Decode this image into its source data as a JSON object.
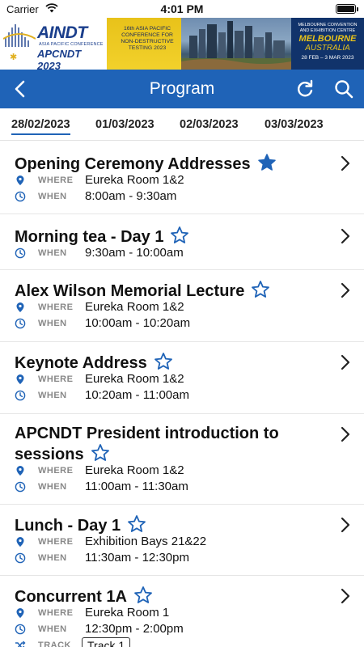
{
  "status_bar": {
    "carrier": "Carrier",
    "time": "4:01 PM"
  },
  "banner": {
    "logo_title": "AINDT",
    "logo_subtitle": "ASIA PACIFIC CONFERENCE",
    "logo_event": "APCNDT 2023",
    "conference_text": "16th ASIA PACIFIC CONFERENCE FOR NON-DESTRUCTIVE TESTING 2023",
    "venue_text": "MELBOURNE CONVENTION AND EXHIBITION CENTRE",
    "city": "MELBOURNE",
    "country": "AUSTRALIA",
    "dates": "28 FEB – 3 MAR 2023"
  },
  "navbar": {
    "title": "Program"
  },
  "tabs": [
    "28/02/2023",
    "01/03/2023",
    "02/03/2023",
    "03/03/2023"
  ],
  "labels": {
    "where": "WHERE",
    "when": "WHEN",
    "track": "TRACK"
  },
  "items": [
    {
      "title": "Opening Ceremony Addresses",
      "starred": true,
      "where": "Eureka Room 1&2",
      "when": "8:00am - 9:30am"
    },
    {
      "title": "Morning tea - Day 1",
      "starred": false,
      "when": "9:30am - 10:00am"
    },
    {
      "title": "Alex Wilson Memorial Lecture",
      "starred": false,
      "where": "Eureka Room 1&2",
      "when": "10:00am - 10:20am"
    },
    {
      "title": "Keynote Address",
      "starred": false,
      "where": "Eureka Room 1&2",
      "when": "10:20am - 11:00am"
    },
    {
      "title": "APCNDT President introduction to sessions",
      "starred": false,
      "where": "Eureka Room 1&2",
      "when": "11:00am - 11:30am"
    },
    {
      "title": "Lunch - Day 1",
      "starred": false,
      "where": "Exhibition Bays 21&22",
      "when": "11:30am - 12:30pm"
    },
    {
      "title": "Concurrent 1A",
      "starred": false,
      "where": "Eureka Room 1",
      "when": "12:30pm - 2:00pm",
      "track": "Track 1"
    }
  ],
  "colors": {
    "primary": "#1f63b7",
    "banner_gold": "#e8c21a",
    "banner_navy": "#11336b"
  }
}
